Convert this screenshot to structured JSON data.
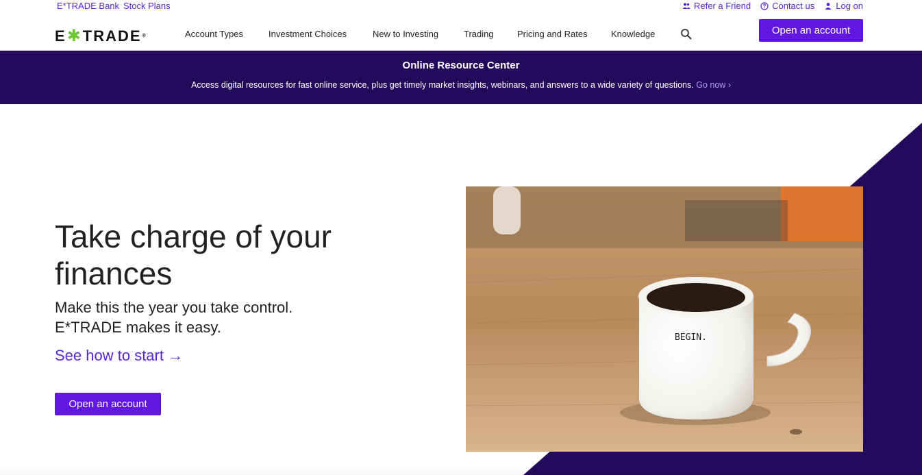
{
  "utility": {
    "left_links": [
      "E*TRADE Bank",
      "Stock Plans"
    ],
    "refer": "Refer a Friend",
    "contact": "Contact us",
    "login": "Log on"
  },
  "nav": {
    "logo_left": "E",
    "logo_star": "✱",
    "logo_right": "TRADE",
    "logo_reg": "®",
    "items": [
      "Account Types",
      "Investment Choices",
      "New to Investing",
      "Trading",
      "Pricing and Rates",
      "Knowledge"
    ],
    "cta": "Open an account"
  },
  "banner": {
    "title": "Online Resource Center",
    "text": "Access digital resources for fast online service, plus get timely market insights, webinars, and answers to a wide variety of questions.",
    "link": "Go now ›"
  },
  "hero": {
    "heading": "Take charge of your finances",
    "subheading": "Make this the year you take control. E*TRADE makes it easy.",
    "link": "See how to start →",
    "cta": "Open an account",
    "mug_text": "BEGIN."
  },
  "colors": {
    "brand_purple": "#6216e1",
    "link_purple": "#5627d8",
    "banner_bg": "#240a5a",
    "logo_green": "#6dc82e"
  }
}
